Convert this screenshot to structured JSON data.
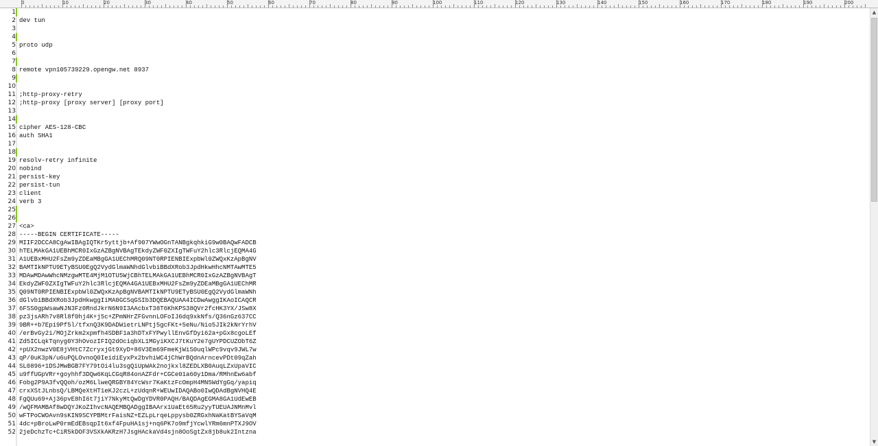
{
  "ruler": {
    "labels": [
      "0",
      "10",
      "20",
      "30",
      "40",
      "50",
      "60",
      "70",
      "80",
      "90",
      "100",
      "110",
      "120",
      "130",
      "140",
      "150",
      "160",
      "170",
      "180",
      "190",
      "200"
    ]
  },
  "editor": {
    "lines": [
      {
        "n": "1",
        "t": "",
        "mod": true
      },
      {
        "n": "2",
        "t": "dev tun",
        "mod": false
      },
      {
        "n": "3",
        "t": "",
        "mod": false
      },
      {
        "n": "4",
        "t": "",
        "mod": true
      },
      {
        "n": "5",
        "t": "proto udp",
        "mod": false
      },
      {
        "n": "6",
        "t": "",
        "mod": false
      },
      {
        "n": "7",
        "t": "",
        "mod": true
      },
      {
        "n": "8",
        "t": "remote vpn105739229.opengw.net 8937",
        "mod": false
      },
      {
        "n": "9",
        "t": "",
        "mod": true
      },
      {
        "n": "10",
        "t": "",
        "mod": false
      },
      {
        "n": "11",
        "t": ";http-proxy-retry",
        "mod": false
      },
      {
        "n": "12",
        "t": ";http-proxy [proxy server] [proxy port]",
        "mod": false
      },
      {
        "n": "13",
        "t": "",
        "mod": false
      },
      {
        "n": "14",
        "t": "",
        "mod": true
      },
      {
        "n": "15",
        "t": "cipher AES-128-CBC",
        "mod": false
      },
      {
        "n": "16",
        "t": "auth SHA1",
        "mod": false
      },
      {
        "n": "17",
        "t": "",
        "mod": false
      },
      {
        "n": "18",
        "t": "",
        "mod": true
      },
      {
        "n": "19",
        "t": "resolv-retry infinite",
        "mod": false
      },
      {
        "n": "20",
        "t": "nobind",
        "mod": false
      },
      {
        "n": "21",
        "t": "persist-key",
        "mod": false
      },
      {
        "n": "22",
        "t": "persist-tun",
        "mod": false
      },
      {
        "n": "23",
        "t": "client",
        "mod": false
      },
      {
        "n": "24",
        "t": "verb 3",
        "mod": false
      },
      {
        "n": "25",
        "t": "",
        "mod": true
      },
      {
        "n": "26",
        "t": "",
        "mod": true
      },
      {
        "n": "27",
        "t": "<ca>",
        "mod": false
      },
      {
        "n": "28",
        "t": "-----BEGIN CERTIFICATE-----",
        "mod": false
      },
      {
        "n": "29",
        "t": "MIIF2DCCA8CgAwIBAgIQTKr5yttjb+Af907YWwOGnTANBgkqhkiG9w0BAQwFADCB",
        "mod": false
      },
      {
        "n": "30",
        "t": "hTELMAkGA1UEBhMCR0IxGzAZBgNVBAgTEkdyZWF0ZXIgTWFuY2hlc3RlcjEQMA4G",
        "mod": false
      },
      {
        "n": "31",
        "t": "A1UEBxMHU2FsZm9yZDEaMBgGA1UEChMRQ09NT0RPIENBIExpbWl0ZWQxKzApBgNV",
        "mod": false
      },
      {
        "n": "32",
        "t": "BAMTIkNPTU9ETyBSU0EgQ2VydGlmaWNhdGlvbiBBdXRob3JpdHkwHhcNMTAwMTE5",
        "mod": false
      },
      {
        "n": "33",
        "t": "MDAwMDAwWhcNMzgwMTE4MjM1OTU5WjCBhTELMAkGA1UEBhMCR0IxGzAZBgNVBAgT",
        "mod": false
      },
      {
        "n": "34",
        "t": "EkdyZWF0ZXIgTWFuY2hlc3RlcjEQMA4GA1UEBxMHU2FsZm9yZDEaMBgGA1UEChMR",
        "mod": false
      },
      {
        "n": "35",
        "t": "Q09NT0RPIENBIExpbWl0ZWQxKzApBgNVBAMTIkNPTU9ETyBSU0EgQ2VydGlmaWNh",
        "mod": false
      },
      {
        "n": "36",
        "t": "dGlvbiBBdXRob3JpdHkwggIiMA0GCSqGSIb3DQEBAQUAA4ICDwAwggIKAoICAQCR",
        "mod": false
      },
      {
        "n": "37",
        "t": "6FSS0gpWsawNJN3Fz0RndJkrN6N9I3AAcbxT38T6KhKPS38QVr2fcHK3YX/JSw8X",
        "mod": false
      },
      {
        "n": "38",
        "t": "pz3jsARh7v8Rl8f0hj4K+j5c+ZPmNHrZFGvnnLOFoIJ6dq9xkNfs/Q36nGz637CC",
        "mod": false
      },
      {
        "n": "39",
        "t": "9BR++b7Epi9Pf5l/tfxnQ3K9DADWietrLNPtj5gcFKt+5eNu/Nio5JIk2kNrYrhV",
        "mod": false
      },
      {
        "n": "40",
        "t": "/erBvGy2i/MOjZrkm2xpmfh4SDBF1a3hDTxFYPwyllEnvGfDyi62a+pGx8cgoLEf",
        "mod": false
      },
      {
        "n": "41",
        "t": "Zd5ICLqkTqnyg0Y3hOvozIFIQ2dOciqbXL1MGyiKXCJ7tKuY2e7gUYPDCUZObT6Z",
        "mod": false
      },
      {
        "n": "42",
        "t": "+pUX2nwzV0E8jVHtC7ZcryxjGt9XyD+86V3Em69FmeKjWiS0uqlWPc9vqv9JWL7w",
        "mod": false
      },
      {
        "n": "43",
        "t": "qP/0uK3pN/u6uPQLOvnoQ0IeidiEyxPx2bvhiWC4jChWrBQdnArncevPDt09qZah",
        "mod": false
      },
      {
        "n": "44",
        "t": "SL0896+1DSJMwBGB7FY79tOi4lu3sgQiUpWAk2nojkxl8ZEDLXB0AuqLZxUpaVIC",
        "mod": false
      },
      {
        "n": "45",
        "t": "u9ffUGpVRr+goyhhf3DQw6KqLCGqR84onAZFdr+CGCe01a60y1Dma/RMhnEw6abf",
        "mod": false
      },
      {
        "n": "46",
        "t": "Fobg2P9A3fvQQoh/ozM6LlweQRGBY84YcWsr7KaKtzFcOmpH4MN5WdYgGq/yapiq",
        "mod": false
      },
      {
        "n": "47",
        "t": "crxXStJLnbsQ/LBMQeXtHT1eKJ2czL+zUdqnR+WEUwIDAQABo0IwQDAdBgNVHQ4E",
        "mod": false
      },
      {
        "n": "48",
        "t": "FgQUu69+Aj36pvE8hI6t7jiY7NkyMtQwDgYDVR0PAQH/BAQDAgEGMA8GA1UdEwEB",
        "mod": false
      },
      {
        "n": "49",
        "t": "/wQFMAMBAf8wDQYJKoZIhvcNAQEMBQADggIBAArx1UaEt65Ru2yyTUEUAJNMnMvl",
        "mod": false
      },
      {
        "n": "50",
        "t": "wFTPoCWOAvn9sKIN9SCYPBMtrFaisNZ+EZLpLrqeLppysb0ZRGxhNaKatBYSaVqM",
        "mod": false
      },
      {
        "n": "51",
        "t": "4dc+pBroLwP0rmEdEBsqpIt6xf4FpuHA1sj+nq6PK7o9mfjYcwlYRm6mnPTXJ9OV",
        "mod": false
      },
      {
        "n": "52",
        "t": "2jeDchzTc+CiR5kDOF3VSXkAKRzH7JsgHAckaVd4sjn8OoSgtZx8jb8uk2Intzna",
        "mod": false
      }
    ]
  },
  "scrollbar": {
    "up_icon": "▲",
    "down_icon": "▼"
  }
}
